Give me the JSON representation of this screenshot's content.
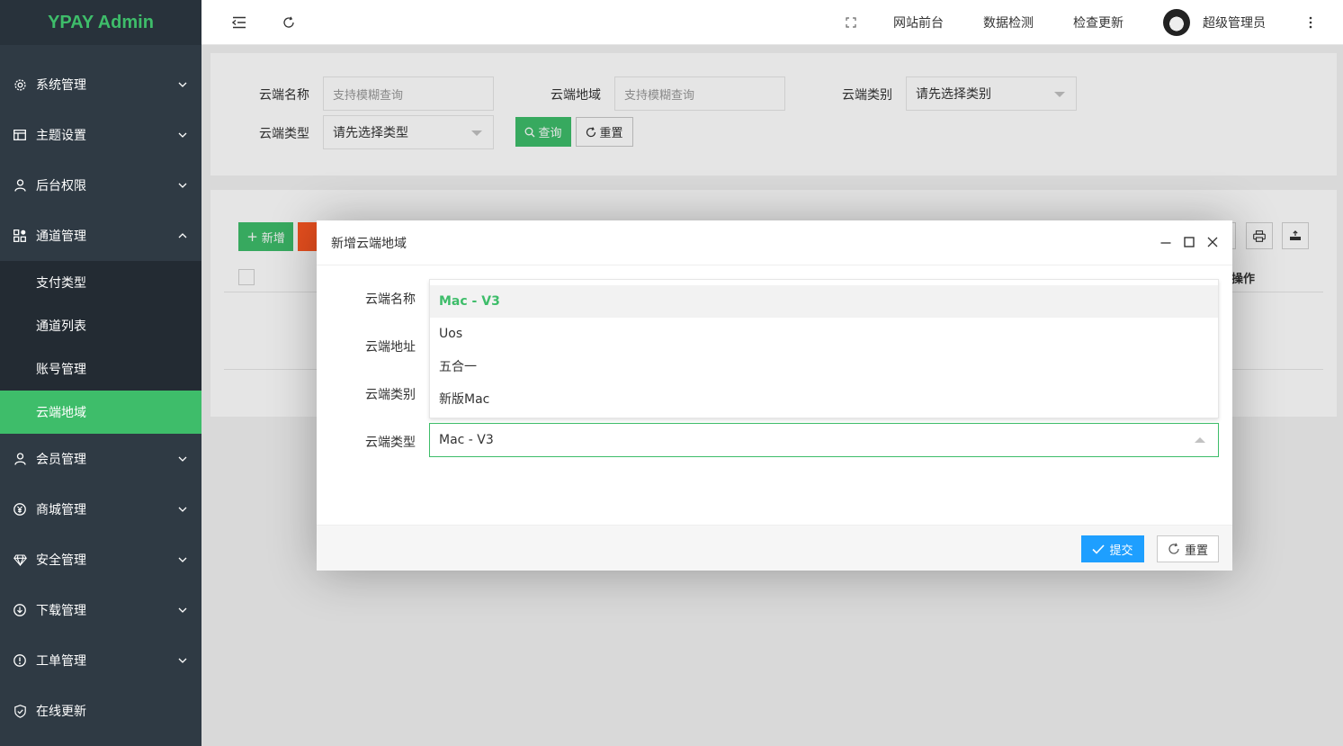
{
  "app": {
    "logo": "YPAY Admin"
  },
  "sidebar": {
    "items": [
      {
        "label": "系统管理",
        "icon": "gear-icon"
      },
      {
        "label": "主题设置",
        "icon": "window-icon"
      },
      {
        "label": "后台权限",
        "icon": "user-icon"
      },
      {
        "label": "通道管理",
        "icon": "apps-icon",
        "expanded": true
      }
    ],
    "subitems": [
      {
        "label": "支付类型"
      },
      {
        "label": "通道列表"
      },
      {
        "label": "账号管理"
      },
      {
        "label": "云端地域",
        "active": true
      }
    ],
    "items_after": [
      {
        "label": "会员管理",
        "icon": "user-icon"
      },
      {
        "label": "商城管理",
        "icon": "yen-icon"
      },
      {
        "label": "安全管理",
        "icon": "diamond-icon"
      },
      {
        "label": "下载管理",
        "icon": "download-icon"
      },
      {
        "label": "工单管理",
        "icon": "info-icon"
      },
      {
        "label": "在线更新",
        "icon": "shield-check-icon"
      }
    ],
    "accent": "#3ebd6a",
    "bg": "#2f3a44"
  },
  "header": {
    "site_front": "网站前台",
    "data_check": "数据检测",
    "check_update": "检查更新",
    "user_name": "超级管理员"
  },
  "search": {
    "name_label": "云端名称",
    "name_placeholder": "支持模糊查询",
    "region_label": "云端地域",
    "region_placeholder": "支持模糊查询",
    "category_label": "云端类别",
    "category_value": "请先选择类别",
    "type_label": "云端类型",
    "type_value": "请先选择类型",
    "query_btn": "查询",
    "reset_btn": "重置"
  },
  "table": {
    "add_btn": "新增",
    "ops_header": "操作"
  },
  "modal": {
    "title": "新增云端地域",
    "fields": {
      "name": "云端名称",
      "address": "云端地址",
      "category": "云端类别",
      "type": "云端类型"
    },
    "type_options": [
      "Mac - V3",
      "Uos",
      "五合一",
      "新版Mac"
    ],
    "type_selected": "Mac - V3",
    "submit_btn": "提交",
    "reset_btn": "重置",
    "submit_color": "#1e9fff"
  }
}
